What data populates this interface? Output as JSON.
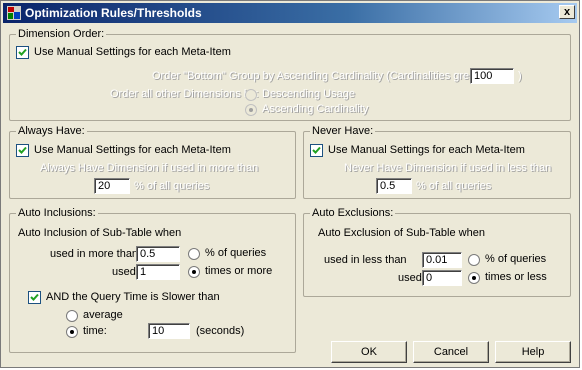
{
  "window": {
    "title": "Optimization Rules/Thresholds",
    "close_glyph": "x"
  },
  "dimension_order": {
    "legend": "Dimension Order:",
    "manual_label": "Use Manual Settings for each Meta-Item",
    "order_bottom_label": "Order \"Bottom\" Group by Ascending Cardinality (Cardinalities greater than",
    "order_bottom_value": "100",
    "close_paren": ")",
    "order_all_label": "Order all other Dimensions by:",
    "option_descending": "Descending Usage",
    "option_ascending": "Ascending Cardinality"
  },
  "always_have": {
    "legend": "Always Have:",
    "manual_label": "Use Manual Settings for each Meta-Item",
    "desc": "Always Have Dimension if used in more than",
    "value": "20",
    "suffix": "% of all queries"
  },
  "never_have": {
    "legend": "Never Have:",
    "manual_label": "Use Manual Settings for each Meta-Item",
    "desc": "Never Have Dimension if used in less than",
    "value": "0.5",
    "suffix": "% of all queries"
  },
  "auto_inclusions": {
    "legend": "Auto Inclusions:",
    "heading": "Auto Inclusion of Sub-Table when",
    "more_label": "used in more than",
    "more_value": "0.5",
    "pct_label": "% of queries",
    "used_label": "used",
    "used_value": "1",
    "times_label": "times or more",
    "and_query_label": "AND the Query Time is Slower than",
    "average_label": "average",
    "time_label": "time:",
    "time_value": "10",
    "seconds_label": "(seconds)"
  },
  "auto_exclusions": {
    "legend": "Auto Exclusions:",
    "heading": "Auto Exclusion of Sub-Table when",
    "less_label": "used in less than",
    "less_value": "0.01",
    "pct_label": "% of queries",
    "used_label": "used",
    "used_value": "0",
    "times_label": "times or less"
  },
  "buttons": {
    "ok": "OK",
    "cancel": "Cancel",
    "help": "Help"
  }
}
